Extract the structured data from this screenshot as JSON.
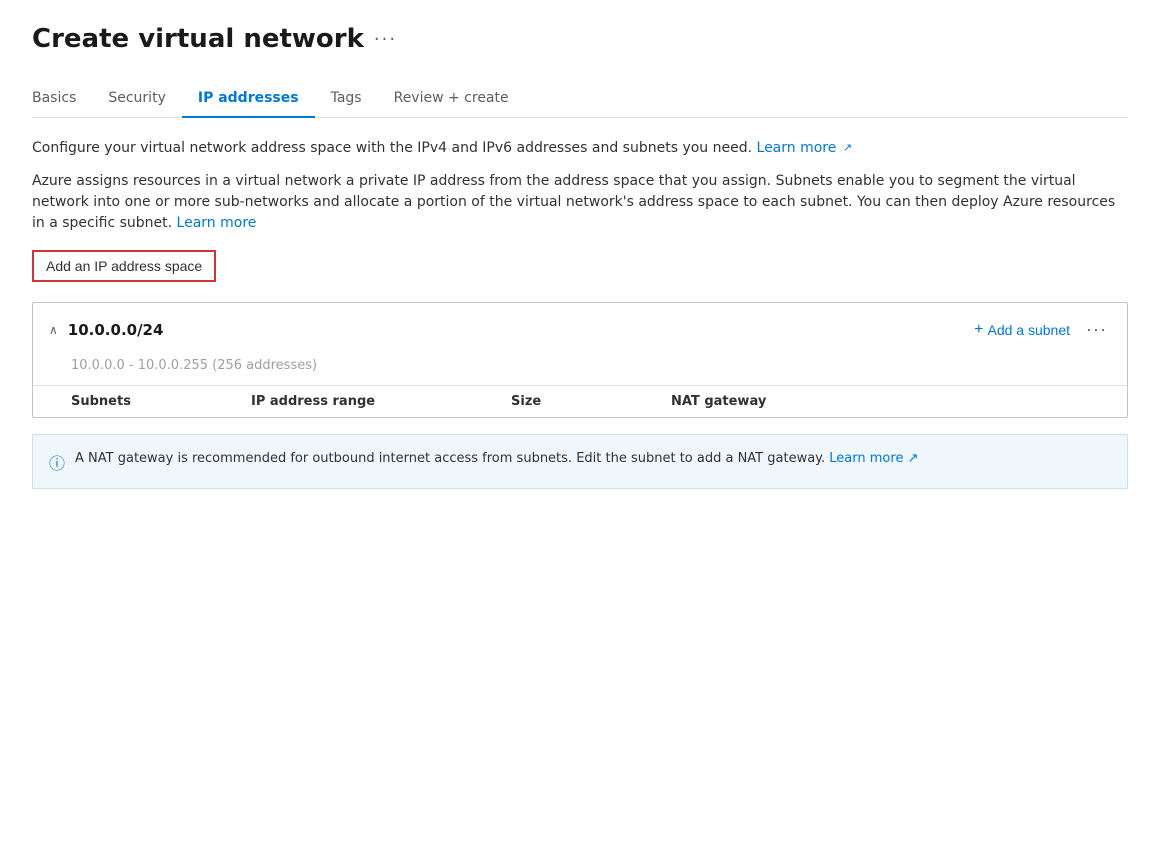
{
  "page": {
    "title": "Create virtual network",
    "more_label": "···"
  },
  "tabs": [
    {
      "id": "basics",
      "label": "Basics",
      "active": false
    },
    {
      "id": "security",
      "label": "Security",
      "active": false
    },
    {
      "id": "ip-addresses",
      "label": "IP addresses",
      "active": true
    },
    {
      "id": "tags",
      "label": "Tags",
      "active": false
    },
    {
      "id": "review-create",
      "label": "Review + create",
      "active": false
    }
  ],
  "description": {
    "line1_start": "Configure your virtual network address space with the IPv4 and IPv6 addresses and subnets you need.",
    "line1_link": "Learn more",
    "line2": "Azure assigns resources in a virtual network a private IP address from the address space that you assign. Subnets enable you to segment the virtual network into one or more sub-networks and allocate a portion of the virtual network's address space to each subnet. You can then deploy Azure resources in a specific subnet.",
    "line2_link": "Learn more"
  },
  "add_ip_button": {
    "label": "Add an IP address space"
  },
  "ip_space": {
    "cidr": "10.0.0.0/24",
    "range_text": "10.0.0.0 - 10.0.0.255 (256 addresses)",
    "add_subnet_label": "Add a subnet",
    "columns": [
      "Subnets",
      "IP address range",
      "Size",
      "NAT gateway"
    ]
  },
  "info_banner": {
    "text_start": "A NAT gateway is recommended for outbound internet access from subnets. Edit the subnet to add a NAT gateway.",
    "link_text": "Learn more"
  }
}
